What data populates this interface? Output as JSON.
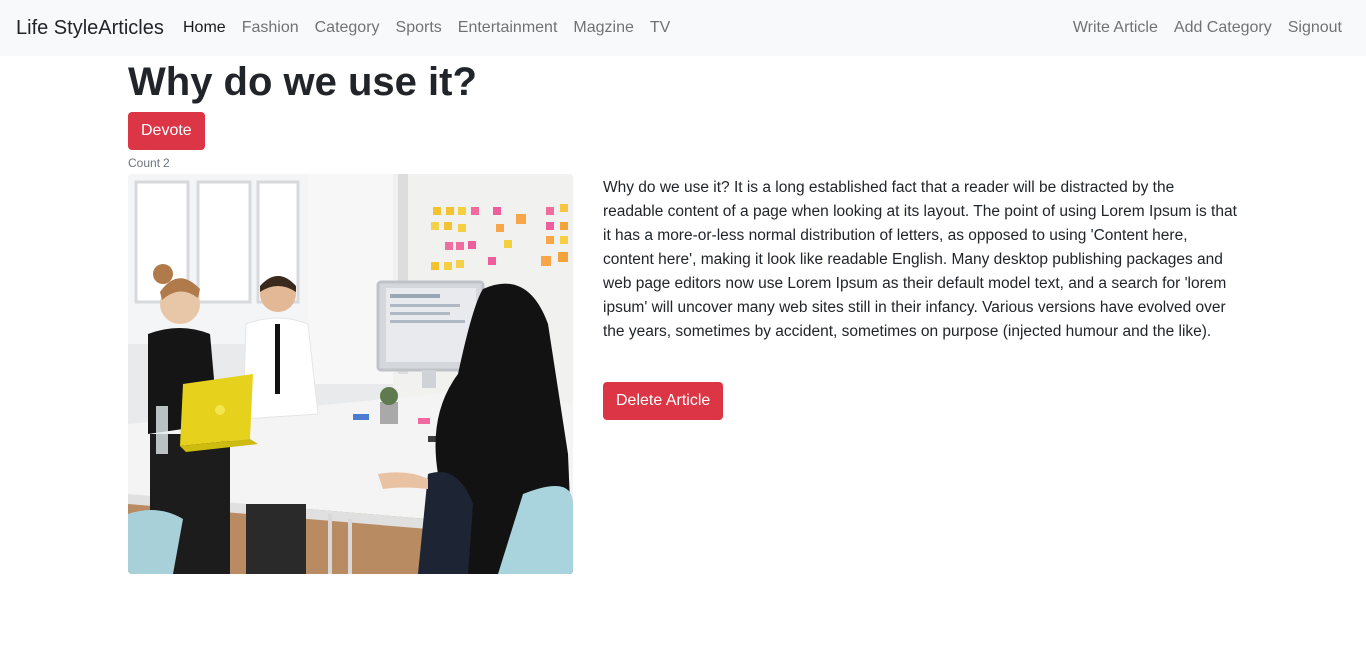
{
  "navbar": {
    "brand": "Life StyleArticles",
    "left_links": [
      "Home",
      "Fashion",
      "Category",
      "Sports",
      "Entertainment",
      "Magzine",
      "TV"
    ],
    "active_link": "Home",
    "right_links": [
      "Write Article",
      "Add Category",
      "Signout"
    ]
  },
  "article": {
    "title": "Why do we use it?",
    "devote_label": "Devote",
    "count_label": "Count",
    "count_value": "2",
    "image_icon": "office-meeting-photo",
    "body": "Why do we use it? It is a long established fact that a reader will be distracted by the readable content of a page when looking at its layout. The point of using Lorem Ipsum is that it has a more-or-less normal distribution of letters, as opposed to using 'Content here, content here', making it look like readable English. Many desktop publishing packages and web page editors now use Lorem Ipsum as their default model text, and a search for 'lorem ipsum' will uncover many web sites still in their infancy. Various versions have evolved over the years, sometimes by accident, sometimes on purpose (injected humour and the like).",
    "delete_label": "Delete Article"
  },
  "colors": {
    "navbar_bg": "#f8f9fa",
    "danger": "#dc3545",
    "text": "#212529",
    "muted": "#6c757d"
  }
}
